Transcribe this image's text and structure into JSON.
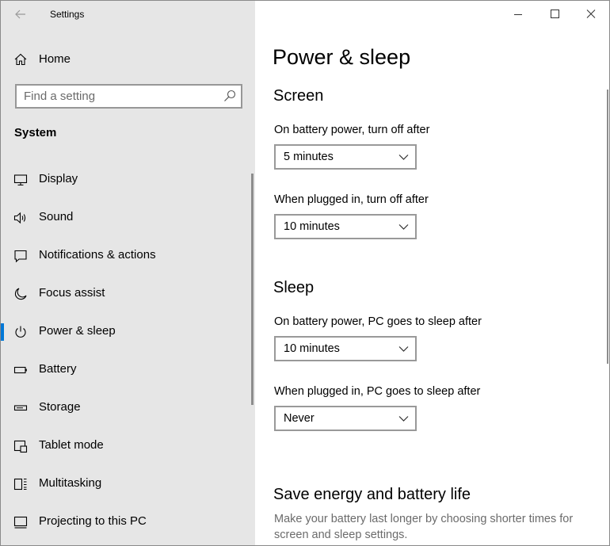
{
  "window": {
    "title": "Settings"
  },
  "sidebar": {
    "home_label": "Home",
    "search_placeholder": "Find a setting",
    "section_title": "System",
    "items": [
      {
        "label": "Display",
        "icon": "display-icon",
        "selected": false
      },
      {
        "label": "Sound",
        "icon": "speaker-icon",
        "selected": false
      },
      {
        "label": "Notifications & actions",
        "icon": "notification-icon",
        "selected": false
      },
      {
        "label": "Focus assist",
        "icon": "moon-icon",
        "selected": false
      },
      {
        "label": "Power & sleep",
        "icon": "power-icon",
        "selected": true
      },
      {
        "label": "Battery",
        "icon": "battery-icon",
        "selected": false
      },
      {
        "label": "Storage",
        "icon": "storage-icon",
        "selected": false
      },
      {
        "label": "Tablet mode",
        "icon": "tablet-mode-icon",
        "selected": false
      },
      {
        "label": "Multitasking",
        "icon": "multitasking-icon",
        "selected": false
      },
      {
        "label": "Projecting to this PC",
        "icon": "projecting-icon",
        "selected": false
      }
    ]
  },
  "main": {
    "page_title": "Power & sleep",
    "screen": {
      "title": "Screen",
      "battery_label": "On battery power, turn off after",
      "battery_value": "5 minutes",
      "plugged_label": "When plugged in, turn off after",
      "plugged_value": "10 minutes"
    },
    "sleep": {
      "title": "Sleep",
      "battery_label": "On battery power, PC goes to sleep after",
      "battery_value": "10 minutes",
      "plugged_label": "When plugged in, PC goes to sleep after",
      "plugged_value": "Never"
    },
    "save_energy": {
      "title": "Save energy and battery life",
      "description": "Make your battery last longer by choosing shorter times for screen and sleep settings."
    }
  },
  "colors": {
    "accent": "#0078d7",
    "sidebar_bg": "#e6e6e6",
    "muted_text": "#6b6b6b"
  }
}
